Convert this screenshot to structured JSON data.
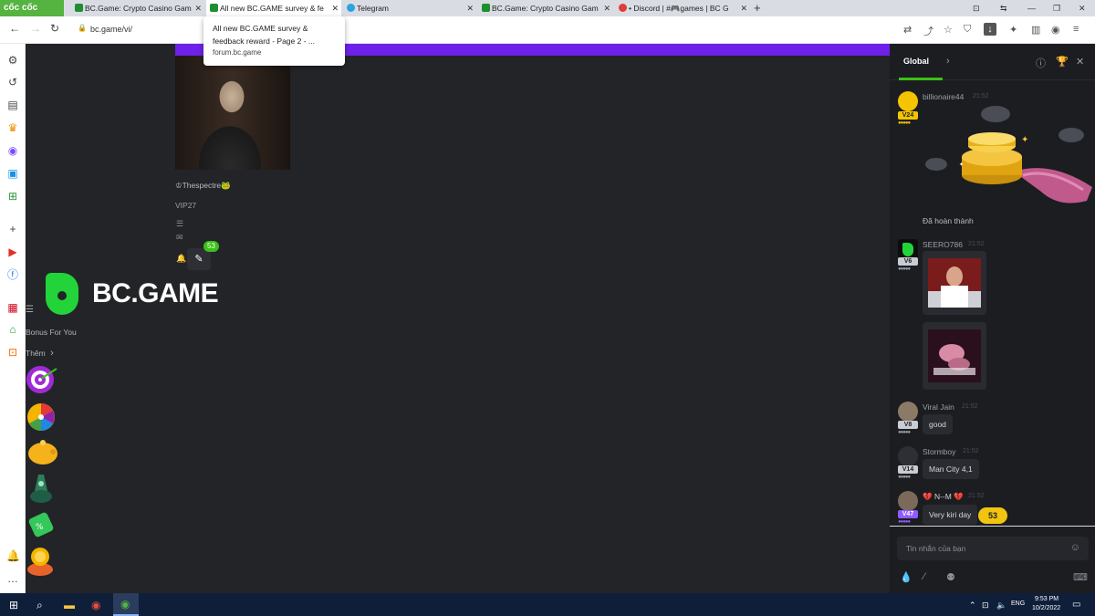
{
  "browser": {
    "logo": "cốc cốc",
    "tabs": [
      {
        "title": "BC.Game: Crypto Casino Gam",
        "active": false
      },
      {
        "title": "All new BC.GAME survey & fe",
        "active": true
      },
      {
        "title": "Telegram",
        "active": false
      },
      {
        "title": "BC.Game: Crypto Casino Gam",
        "active": false
      },
      {
        "title": "• Discord | #🎮games | BC G",
        "active": false
      }
    ],
    "url": "bc.game/vi/",
    "tooltip": {
      "title": "All new BC.GAME survey & feedback reward - Page 2 - ...",
      "domain": "forum.bc.game"
    }
  },
  "profile": {
    "name": "♔Thespectre🐸",
    "vip": "VIP27",
    "notif_count": "53"
  },
  "brand": {
    "name": "BC.GAME"
  },
  "menu": {
    "bonus_label": "Bonus For You",
    "more_label": "Thêm"
  },
  "chat": {
    "tab": "Global",
    "messages": [
      {
        "user": "billionaire44",
        "time": "21:52",
        "vip": "V24",
        "text": "Đã hoàn thành"
      },
      {
        "user": "SEERO786",
        "time": "21:52",
        "vip": "V6"
      },
      {
        "user": "Viral Jain",
        "time": "21:52",
        "vip": "V8",
        "text": "good"
      },
      {
        "user": "Stormboy",
        "time": "21:52",
        "vip": "V14",
        "text": "Man City 4,1"
      },
      {
        "user": "💔 N--M 💔",
        "time": "21:52",
        "vip": "V47",
        "text": "Very kiri day"
      }
    ],
    "new_count": "53",
    "input_placeholder": "Tin nhắn của bạn"
  },
  "taskbar": {
    "lang": "ENG",
    "time": "9:53 PM",
    "date": "10/2/2022"
  },
  "colors": {
    "accent_green": "#3bc117",
    "purple": "#6e21e8",
    "chat_bg": "#1c1d21",
    "main_bg": "#232428"
  }
}
